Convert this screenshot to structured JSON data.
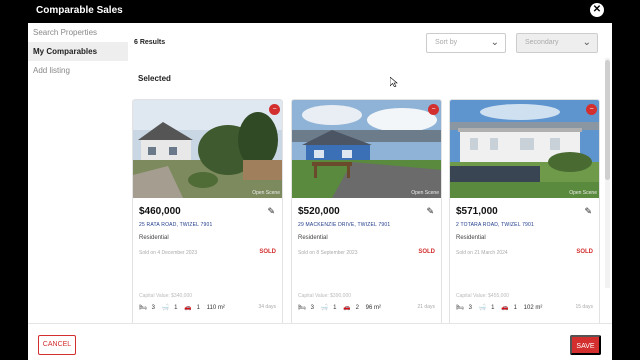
{
  "modal": {
    "title": "Comparable Sales",
    "close_icon": "close-icon"
  },
  "sidebar": {
    "items": [
      {
        "label": "Search Properties",
        "active": false
      },
      {
        "label": "My Comparables",
        "active": true
      },
      {
        "label": "Add listing",
        "active": false
      }
    ]
  },
  "results": {
    "count_label": "6 Results"
  },
  "filters": {
    "sort_placeholder": "Sort by",
    "secondary_placeholder": "Secondary"
  },
  "section": {
    "heading": "Selected"
  },
  "cards": [
    {
      "price": "$460,000",
      "address": "25 RATA ROAD, TWIZEL 7901",
      "type": "Residential",
      "sold_date": "Sold on 4 December 2023",
      "sold": "SOLD",
      "meta": "Capital Value: $340,000",
      "beds": "3",
      "baths": "1",
      "cars": "1",
      "area": "110 m²",
      "days": "34 days",
      "credit": "Open Scene"
    },
    {
      "price": "$520,000",
      "address": "29 MACKENZIE DRIVE, TWIZEL 7901",
      "type": "Residential",
      "sold_date": "Sold on 8 September 2023",
      "sold": "SOLD",
      "meta": "Capital Value: $390,000",
      "beds": "3",
      "baths": "1",
      "cars": "2",
      "area": "96 m²",
      "days": "21 days",
      "credit": "Open Scene"
    },
    {
      "price": "$571,000",
      "address": "2 TOTARA ROAD, TWIZEL 7901",
      "type": "Residential",
      "sold_date": "Sold on 21 March 2024",
      "sold": "SOLD",
      "meta": "Capital Value: $455,000",
      "beds": "3",
      "baths": "1",
      "cars": "1",
      "area": "102 m²",
      "days": "15 days",
      "credit": "Open Scene"
    }
  ],
  "footer": {
    "cancel": "CANCEL",
    "save": "SAVE"
  },
  "colors": {
    "accent": "#d32f2f",
    "titlebar": "#000000",
    "address_link": "#1e3a8a"
  }
}
